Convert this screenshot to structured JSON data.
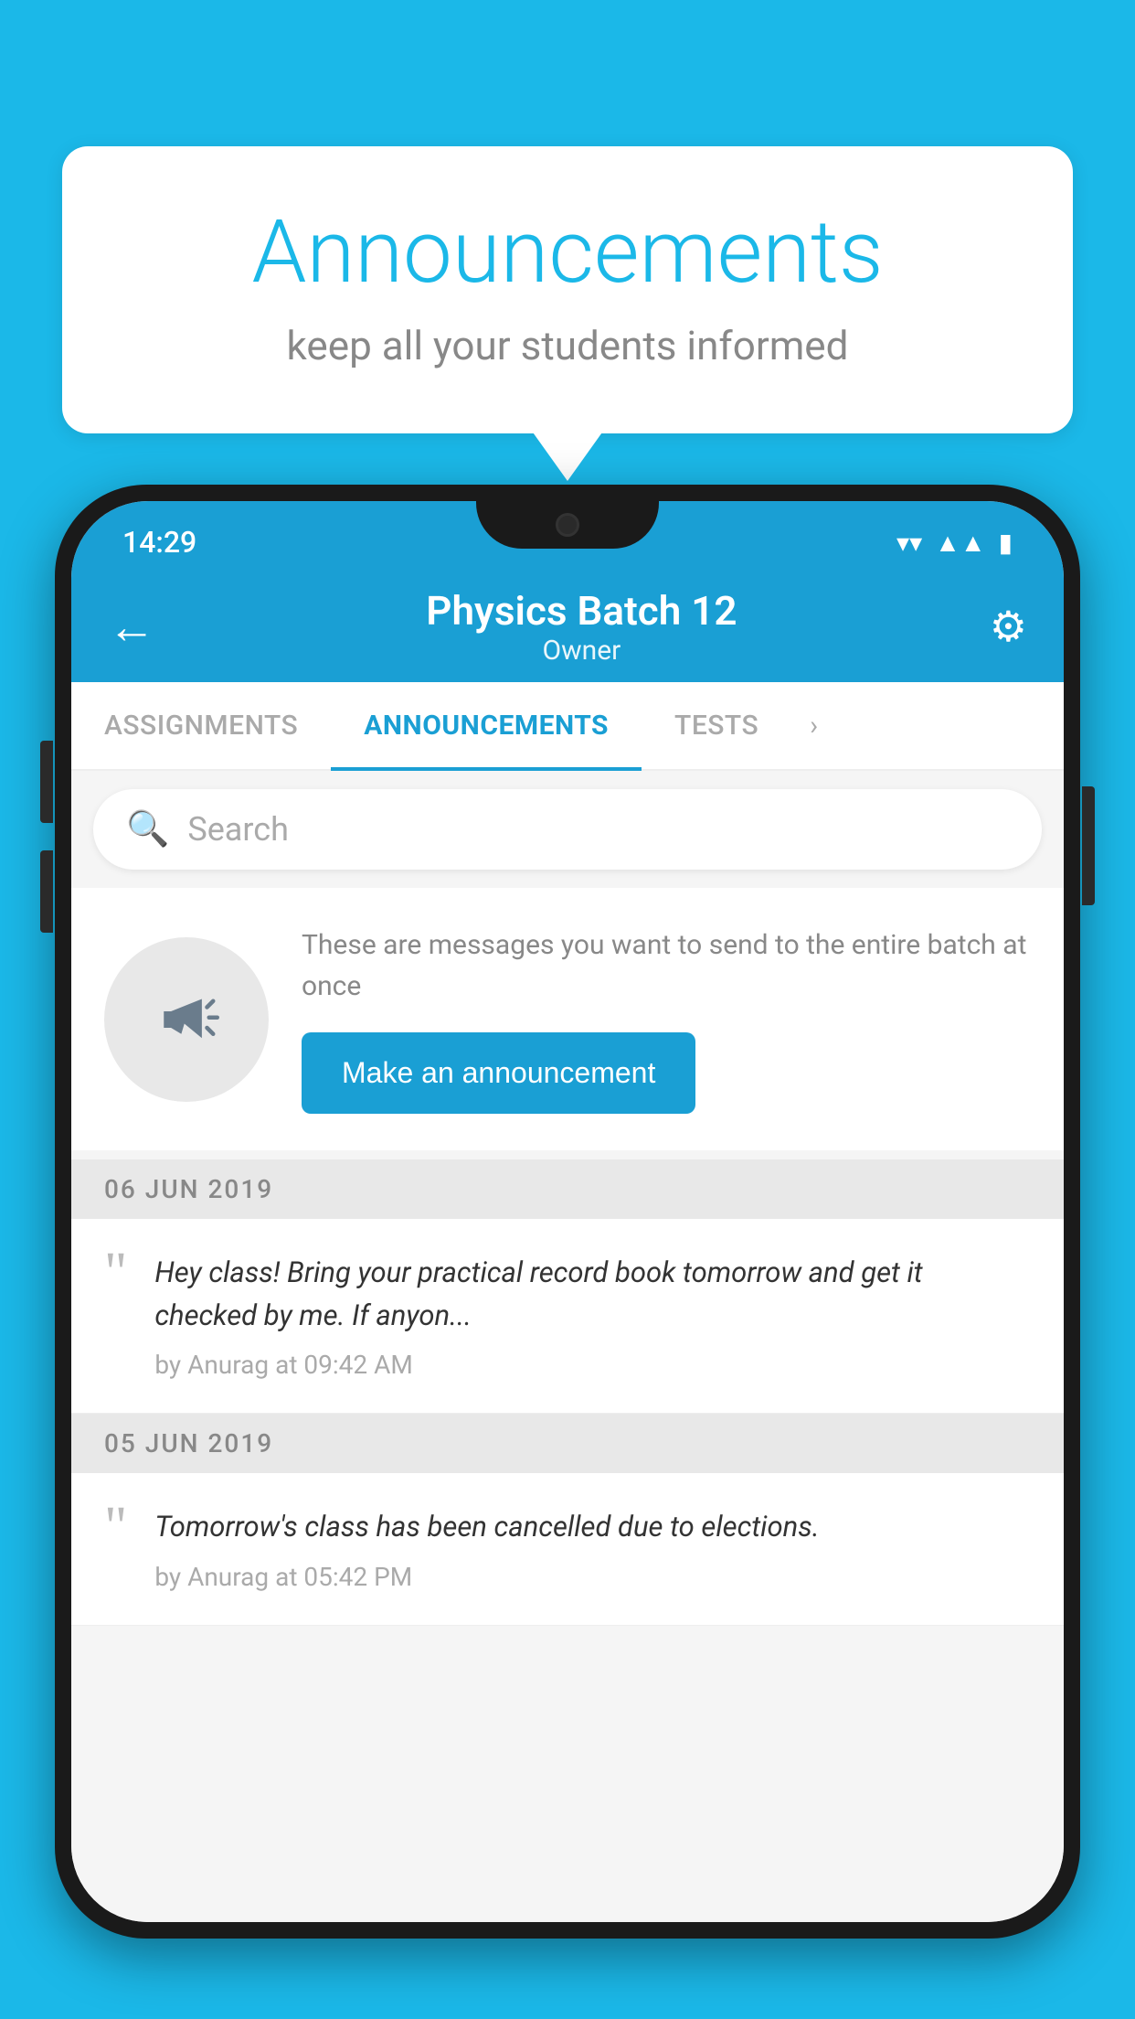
{
  "background_color": "#1bb8e8",
  "speech_bubble": {
    "title": "Announcements",
    "subtitle": "keep all your students informed"
  },
  "phone": {
    "status_bar": {
      "time": "14:29"
    },
    "app_bar": {
      "title": "Physics Batch 12",
      "subtitle": "Owner",
      "back_label": "←",
      "settings_label": "⚙"
    },
    "tabs": [
      {
        "label": "ASSIGNMENTS",
        "active": false
      },
      {
        "label": "ANNOUNCEMENTS",
        "active": true
      },
      {
        "label": "TESTS",
        "active": false
      },
      {
        "label": "›",
        "active": false
      }
    ],
    "search": {
      "placeholder": "Search"
    },
    "announcement_prompt": {
      "description_text": "These are messages you want to send to the entire batch at once",
      "button_label": "Make an announcement"
    },
    "announcements": [
      {
        "date": "06  JUN  2019",
        "items": [
          {
            "text": "Hey class! Bring your practical record book tomorrow and get it checked by me. If anyon...",
            "meta": "by Anurag at 09:42 AM"
          }
        ]
      },
      {
        "date": "05  JUN  2019",
        "items": [
          {
            "text": "Tomorrow's class has been cancelled due to elections.",
            "meta": "by Anurag at 05:42 PM"
          }
        ]
      }
    ]
  }
}
